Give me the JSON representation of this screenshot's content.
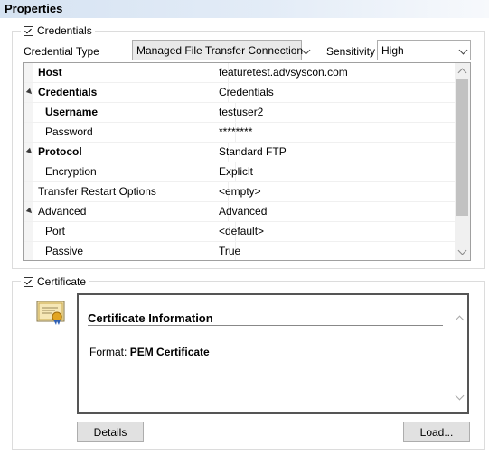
{
  "header": {
    "title": "Properties"
  },
  "credentials_group": {
    "legend": "Credentials",
    "checked": true,
    "credential_type_label": "Credential Type",
    "credential_type_value": "Managed File Transfer Connection",
    "sensitivity_label": "Sensitivity",
    "sensitivity_value": "High",
    "grid": {
      "rows": [
        {
          "label": "Host",
          "value": "featuretest.advsyscon.com"
        },
        {
          "label": "Credentials",
          "value": "Credentials"
        },
        {
          "label": "Username",
          "value": "testuser2"
        },
        {
          "label": "Password",
          "value": "********"
        },
        {
          "label": "Protocol",
          "value": "Standard FTP"
        },
        {
          "label": "Encryption",
          "value": "Explicit"
        },
        {
          "label": "Transfer Restart Options",
          "value": "<empty>"
        },
        {
          "label": "Advanced",
          "value": "Advanced"
        },
        {
          "label": "Port",
          "value": "<default>"
        },
        {
          "label": "Passive",
          "value": "True"
        }
      ]
    }
  },
  "certificate_group": {
    "legend": "Certificate",
    "checked": true,
    "info_title": "Certificate Information",
    "format_label": "Format:",
    "format_value": "PEM Certificate",
    "details_button": "Details",
    "load_button": "Load..."
  },
  "colors": {
    "header_gradient_start": "#d6e3f2",
    "scroll_thumb": "#c2c2c2"
  }
}
